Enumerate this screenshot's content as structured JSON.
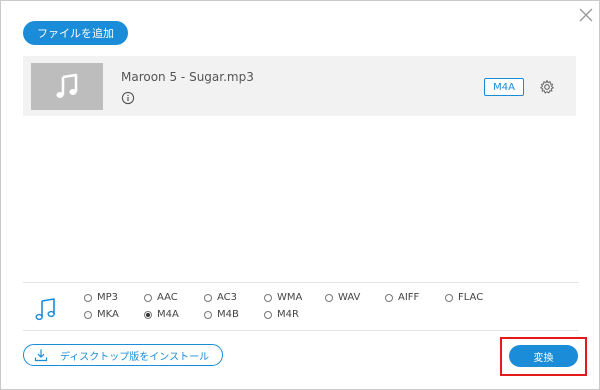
{
  "toolbar": {
    "add_file_label": "ファイルを追加"
  },
  "file": {
    "name": "Maroon 5 - Sugar.mp3",
    "format_badge": "M4A"
  },
  "formats": {
    "row1": [
      "MP3",
      "AAC",
      "AC3",
      "WMA",
      "WAV",
      "AIFF",
      "FLAC"
    ],
    "row2": [
      "MKA",
      "M4A",
      "M4B",
      "M4R"
    ],
    "selected": "M4A"
  },
  "footer": {
    "install_label": "ディスクトップ版をインストール",
    "convert_label": "変換"
  },
  "colors": {
    "accent": "#1a8cd8",
    "highlight": "#e31b1b",
    "row_bg": "#f2f2f2",
    "thumb_bg": "#bdbdbd"
  },
  "icons": [
    "close-icon",
    "music-note-icon",
    "info-icon",
    "gear-icon",
    "download-icon"
  ]
}
